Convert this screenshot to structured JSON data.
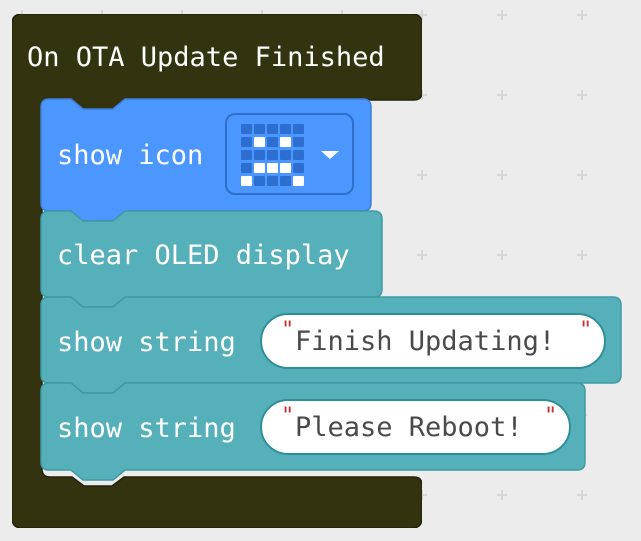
{
  "event_block": {
    "label": "On OTA Update Finished",
    "color": "#33330f"
  },
  "blocks": {
    "show_icon": {
      "label": "show icon",
      "color": "#4c97ff",
      "icon_name": "sad-face-icon"
    },
    "clear_oled": {
      "label": "clear OLED display",
      "color": "#56b0b9"
    },
    "show_string_1": {
      "label": "show string",
      "value": "Finish Updating!",
      "color": "#56b0b9"
    },
    "show_string_2": {
      "label": "show string",
      "value": "Please Reboot!",
      "color": "#56b0b9"
    }
  },
  "quote_char": "\""
}
